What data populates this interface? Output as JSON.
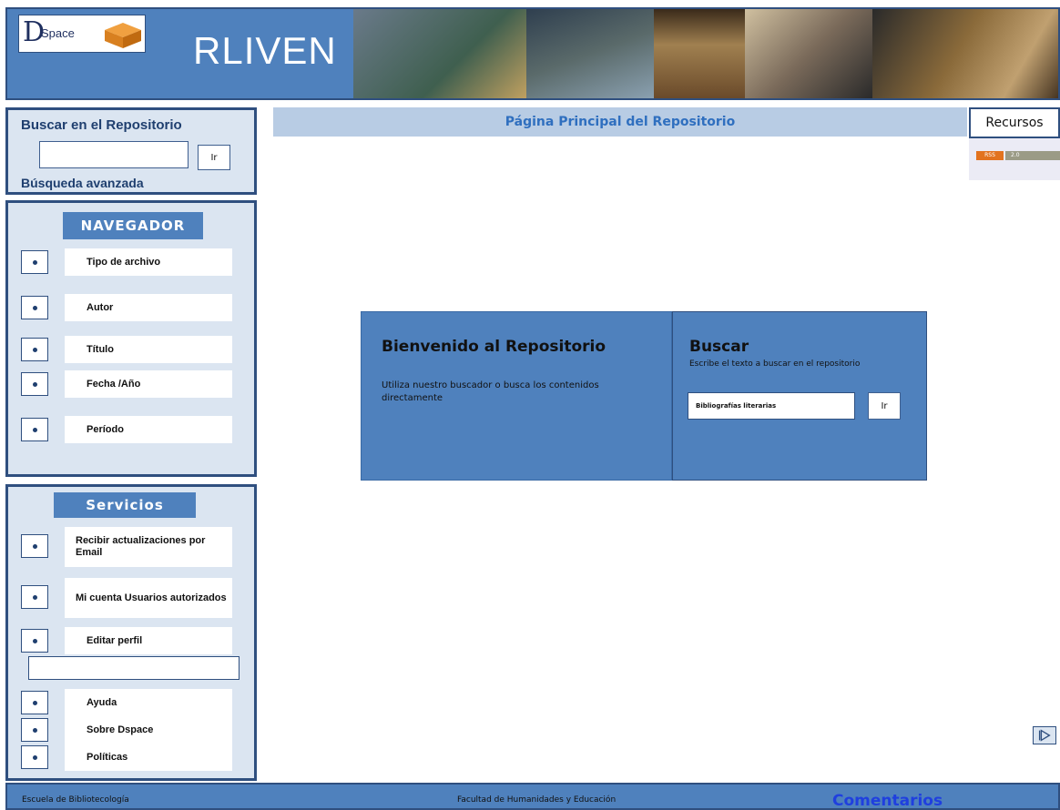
{
  "header": {
    "logo_letter": "D",
    "logo_text": "Space",
    "site_title": "RLIVEN",
    "banner_colors": [
      "#5a6a7a",
      "#2f3f4f",
      "#8a6a4a",
      "#3a3a3a",
      "#b89a6a",
      "#7a5a3a",
      "#2a2a2a"
    ]
  },
  "search": {
    "title": "Buscar en el Repositorio",
    "input_value": "",
    "button_label": "Ir",
    "advanced_label": "Búsqueda avanzada"
  },
  "navigator": {
    "title": "NAVEGADOR",
    "items": [
      {
        "label": "Tipo de archivo"
      },
      {
        "label": "Autor"
      },
      {
        "label": "Título"
      },
      {
        "label": "Fecha /Año"
      },
      {
        "label": "Período"
      }
    ]
  },
  "services": {
    "title": "Servicios",
    "items": [
      {
        "label": "Recibir actualizaciones por Email"
      },
      {
        "label": "Mi cuenta Usuarios autorizados"
      },
      {
        "label": "Editar perfil"
      },
      {
        "label": "Ayuda"
      },
      {
        "label": "Sobre Dspace"
      },
      {
        "label": "Políticas"
      }
    ]
  },
  "main": {
    "page_title": "Página Principal del Repositorio",
    "resources_label": "Recursos",
    "rss_label": "RSS",
    "rss_version": "2.0",
    "welcome_title": "Bienvenido al Repositorio",
    "welcome_text": "Utiliza nuestro buscador o busca los contenidos directamente",
    "buscar_title": "Buscar",
    "buscar_text": "Escribe el texto a buscar en el repositorio",
    "buscar_input_value": "Bibliografías literarias",
    "buscar_button_label": "Ir"
  },
  "footer": {
    "school": "Escuela de Bibliotecología",
    "faculty": "Facultad de Humanidades y Educación",
    "comments": "Comentarios"
  },
  "colors": {
    "accent": "#4f81bd",
    "panel_bg": "#dbe5f1",
    "border": "#2f4f7f"
  }
}
